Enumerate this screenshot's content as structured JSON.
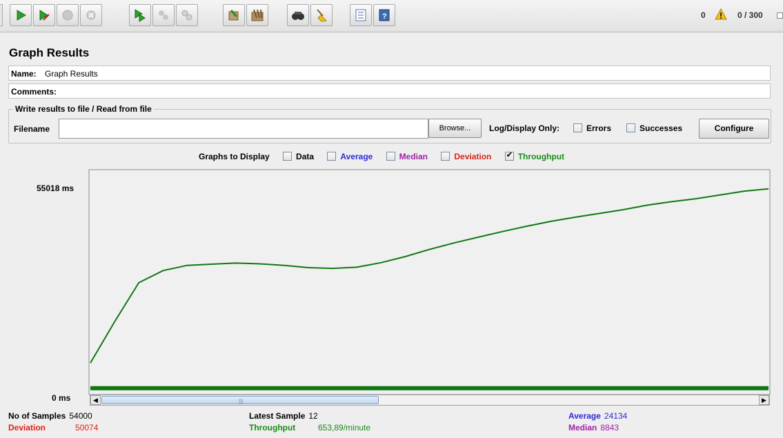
{
  "toolbar": {
    "buttons": [
      "start-icon",
      "start-no-pauses-icon",
      "stop-icon",
      "shutdown-icon",
      "remote-start-all-icon",
      "remote-stop-all-icon",
      "remote-shutdown-all-icon",
      "clear-icon",
      "clear-all-icon",
      "search-icon",
      "reset-search-icon",
      "function-helper-icon",
      "help-icon"
    ],
    "warning_count": "0",
    "threads": "0 / 300"
  },
  "panel": {
    "title": "Graph Results",
    "name_label": "Name:",
    "name_value": "Graph Results",
    "comments_label": "Comments:",
    "comments_value": ""
  },
  "file_group": {
    "title": "Write results to file / Read from file",
    "filename_label": "Filename",
    "filename_value": "",
    "browse_label": "Browse...",
    "log_display_label": "Log/Display Only:",
    "errors_label": "Errors",
    "successes_label": "Successes",
    "configure_label": "Configure"
  },
  "graphs_to_display": {
    "label": "Graphs to Display",
    "options": [
      {
        "label": "Data",
        "checked": false,
        "color": "#000000"
      },
      {
        "label": "Average",
        "checked": false,
        "color": "#2b2bd6"
      },
      {
        "label": "Median",
        "checked": false,
        "color": "#a020a8"
      },
      {
        "label": "Deviation",
        "checked": false,
        "color": "#e0201a"
      },
      {
        "label": "Throughput",
        "checked": true,
        "color": "#1a8a1a"
      }
    ]
  },
  "chart_data": {
    "type": "line",
    "y_max_label": "55018 ms",
    "y_min_label": "0 ms",
    "ylim": [
      0,
      55018
    ],
    "series": [
      {
        "name": "Throughput",
        "color": "#117711",
        "values_ms": [
          7600,
          18500,
          28800,
          32000,
          33400,
          33700,
          34000,
          33800,
          33400,
          32800,
          32600,
          32900,
          34100,
          35700,
          37600,
          39300,
          40800,
          42300,
          43700,
          45000,
          46100,
          47100,
          48100,
          49300,
          50200,
          51000,
          52000,
          53000,
          53600
        ]
      }
    ],
    "baseline_band_ms": 400
  },
  "stats": {
    "samples_label": "No of Samples",
    "samples_value": "54000",
    "deviation_label": "Deviation",
    "deviation_value": "50074",
    "latest_label": "Latest Sample",
    "latest_value": "12",
    "throughput_label": "Throughput",
    "throughput_value": "653,89/minute",
    "average_label": "Average",
    "average_value": "24134",
    "median_label": "Median",
    "median_value": "8843",
    "colors": {
      "deviation": "#e0201a",
      "throughput": "#1a8a1a",
      "average": "#2b2bd6",
      "median": "#a020a8"
    }
  }
}
